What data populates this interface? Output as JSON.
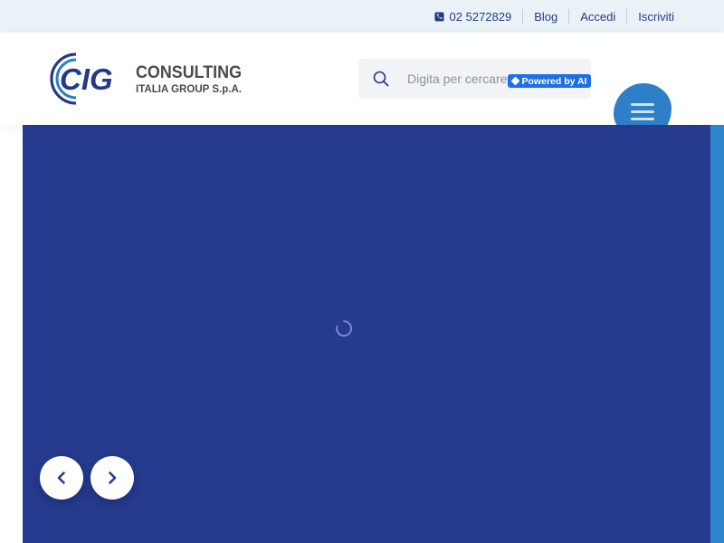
{
  "topbar": {
    "phone": "02 5272829",
    "links": [
      "Blog",
      "Accedi",
      "Iscriviti"
    ]
  },
  "header": {
    "logo": {
      "mark": "CIG",
      "line1": "CONSULTING",
      "line2": "ITALIA GROUP S.p.A."
    },
    "search": {
      "placeholder": "Digita per cercare...",
      "badge": "Powered by AI"
    },
    "menu_icon": "hamburger-icon"
  },
  "hero": {
    "loading_icon": "spinner-icon",
    "prev_icon": "chevron-left-icon",
    "next_icon": "chevron-right-icon"
  },
  "colors": {
    "navy": "#233a86",
    "hero": "#263b8f",
    "accent_blue": "#2d7fc8",
    "badge_blue": "#1f6fe0",
    "topbar_bg": "#eaf2f8"
  }
}
